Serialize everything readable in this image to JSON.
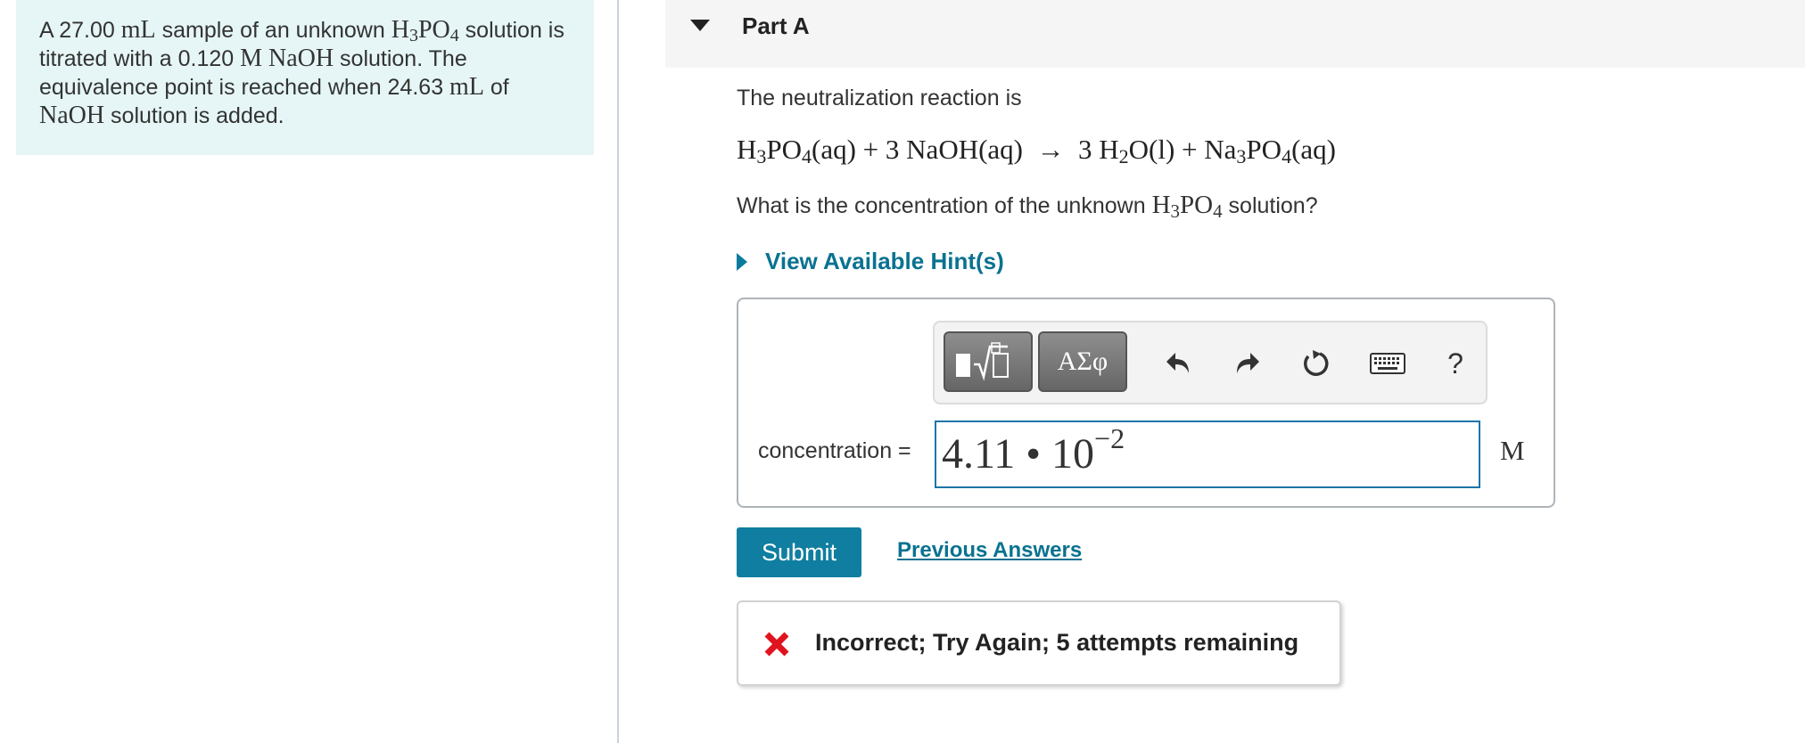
{
  "problem": {
    "t1": "A 27.00 ",
    "u_ml_1": "mL",
    "t2": " sample of an unknown ",
    "acid_h": "H",
    "acid_3": "3",
    "acid_po": "PO",
    "acid_4": "4",
    "t3": " solution is titrated with a 0.120 ",
    "u_m": "M",
    "base": "NaOH",
    "t4": " solution. The equivalence point is reached when 24.63 ",
    "u_ml_2": "mL",
    "t5": " of ",
    "base_2": "NaOH",
    "t6": " solution is added."
  },
  "part": {
    "title": "Part A"
  },
  "content": {
    "intro": "The neutralization reaction is",
    "equation": {
      "a": "H",
      "a3": "3",
      "b": "PO",
      "b4": "4",
      "c": "(aq) + 3 NaOH(aq)  →  3 H",
      "c2": "2",
      "d": "O(l) + Na",
      "d3": "3",
      "e": "PO",
      "e4": "4",
      "f": "(aq)"
    },
    "question_pre": "What is the concentration of the unknown ",
    "q_h": "H",
    "q_3": "3",
    "q_po": "PO",
    "q_4": "4",
    "question_post": " solution?"
  },
  "hint": {
    "label": "View Available Hint(s)"
  },
  "toolbar": {
    "symbols_label": "ΑΣφ",
    "help_label": "?"
  },
  "answer": {
    "label": "concentration =",
    "mantissa": "4.11 • 10",
    "exponent": "−2",
    "unit": "M"
  },
  "actions": {
    "submit_label": "Submit",
    "previous_answers_label": "Previous Answers"
  },
  "feedback": {
    "text": "Incorrect; Try Again; 5 attempts remaining",
    "icon": "incorrect-x-icon",
    "icon_color": "#e0141e"
  },
  "colors": {
    "accent": "#0f7ea0",
    "link": "#0a7290",
    "panel_bg": "#e6f6f6"
  }
}
